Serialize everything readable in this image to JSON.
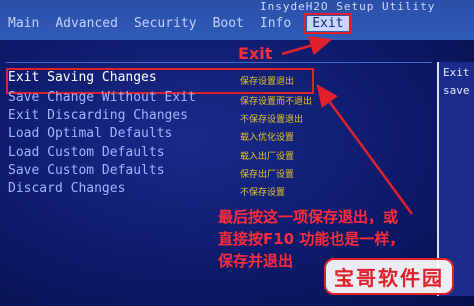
{
  "title": "InsydeH2O Setup Utility",
  "menu": {
    "items": [
      "Main",
      "Advanced",
      "Security",
      "Boot",
      "Info",
      "Exit"
    ],
    "active_index": 5
  },
  "exit_items": [
    {
      "label": "Exit Saving Changes",
      "note": "保存设置退出"
    },
    {
      "label": "Save Change Without Exit",
      "note": "保存设置而不退出"
    },
    {
      "label": "Exit Discarding Changes",
      "note": "不保存设置退出"
    },
    {
      "label": "Load Optimal Defaults",
      "note": "载入优化设置"
    },
    {
      "label": "Load Custom Defaults",
      "note": "载入出厂设置"
    },
    {
      "label": "Save Custom Defaults",
      "note": "保存出厂设置"
    },
    {
      "label": "Discard Changes",
      "note": "不保存设置"
    }
  ],
  "selected_index": 0,
  "right_panel": {
    "lines": [
      "Exit",
      "save"
    ]
  },
  "annotations": {
    "exit_label": "Exit",
    "instruction_lines": [
      "最后按这一项保存退出，或",
      "直接按F10 功能也是一样，",
      "保存并退出"
    ]
  },
  "watermark": "宝哥软件园",
  "colors": {
    "highlight_red": "#e0202a",
    "note_yellow": "#e6c52a"
  }
}
